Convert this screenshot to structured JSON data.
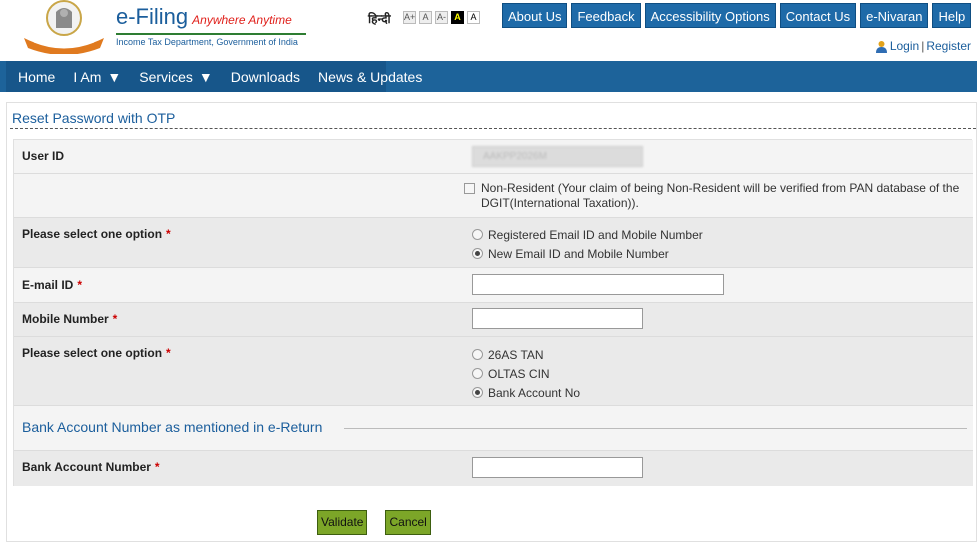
{
  "header": {
    "brand_title": "e-Filing",
    "brand_tagline": "Anywhere Anytime",
    "brand_subtitle": "Income Tax Department, Government of India",
    "hindi_label": "हिन्दी",
    "font_size_controls": [
      "A+",
      "A",
      "A-",
      "A",
      "A"
    ],
    "top_links": [
      "About Us",
      "Feedback",
      "Accessibility Options",
      "Contact Us",
      "e-Nivaran",
      "Help"
    ],
    "login_label": "Login",
    "separator": "|",
    "register_label": "Register"
  },
  "main_nav": [
    {
      "label": "Home",
      "has_caret": false
    },
    {
      "label": "I Am",
      "has_caret": true
    },
    {
      "label": "Services",
      "has_caret": true
    },
    {
      "label": "Downloads",
      "has_caret": false
    },
    {
      "label": "News & Updates",
      "has_caret": false
    }
  ],
  "page": {
    "title": "Reset Password with OTP"
  },
  "form": {
    "user_id": {
      "label": "User ID",
      "value": "AAKPP2026M"
    },
    "non_resident": {
      "checked": false,
      "text": "Non-Resident (Your claim of being Non-Resident will be verified from PAN database of the DGIT(International Taxation))."
    },
    "contact_option": {
      "label": "Please select one option",
      "required_mark": "*",
      "options": [
        {
          "label": "Registered Email ID and Mobile Number",
          "selected": false
        },
        {
          "label": "New Email ID and Mobile Number",
          "selected": true
        }
      ]
    },
    "email": {
      "label": "E-mail ID",
      "required_mark": "*",
      "value": ""
    },
    "mobile": {
      "label": "Mobile Number",
      "required_mark": "*",
      "value": ""
    },
    "validation_option": {
      "label": "Please select one option",
      "required_mark": "*",
      "options": [
        {
          "label": "26AS TAN",
          "selected": false
        },
        {
          "label": "OLTAS CIN",
          "selected": false
        },
        {
          "label": "Bank Account No",
          "selected": true
        }
      ]
    },
    "bank_section_heading": "Bank Account Number as mentioned in e-Return",
    "bank_account": {
      "label": "Bank Account Number",
      "required_mark": "*",
      "value": ""
    }
  },
  "actions": {
    "validate_label": "Validate",
    "cancel_label": "Cancel"
  },
  "colors": {
    "nav_blue": "#1d639a",
    "link_blue": "#1b5e9c",
    "button_green": "#7ca628",
    "required_red": "#cc0000"
  }
}
